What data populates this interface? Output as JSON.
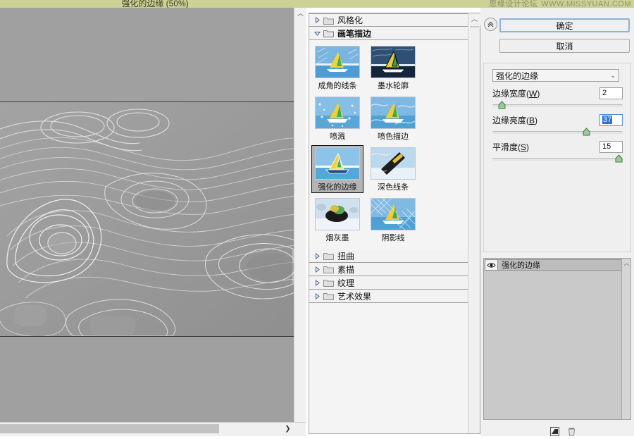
{
  "window": {
    "title": "强化的边缘 (50%)",
    "watermark_cn": "思缘设计论坛",
    "watermark_url": "WWW.MISSYUAN.COM"
  },
  "preview": {
    "zoom_label": "50%",
    "scroll_right_arrow": "❯",
    "scroll_up_arrow": "︿"
  },
  "filters_panel": {
    "categories": [
      {
        "label": "风格化",
        "open": false
      },
      {
        "label": "画笔描边",
        "open": true
      },
      {
        "label": "扭曲",
        "open": false
      },
      {
        "label": "素描",
        "open": false
      },
      {
        "label": "纹理",
        "open": false
      },
      {
        "label": "艺术效果",
        "open": false
      }
    ],
    "thumbnails": [
      {
        "label": "成角的线条",
        "selected": false,
        "style": "angled"
      },
      {
        "label": "墨水轮廓",
        "selected": false,
        "style": "ink"
      },
      {
        "label": "喷溅",
        "selected": false,
        "style": "spatter"
      },
      {
        "label": "喷色描边",
        "selected": false,
        "style": "sprayed"
      },
      {
        "label": "强化的边缘",
        "selected": true,
        "style": "accented"
      },
      {
        "label": "深色线条",
        "selected": false,
        "style": "dark"
      },
      {
        "label": "烟灰墨",
        "selected": false,
        "style": "sumi"
      },
      {
        "label": "阴影线",
        "selected": false,
        "style": "crosshatch"
      }
    ]
  },
  "right_panel": {
    "ok_label": "确定",
    "cancel_label": "取消",
    "collapse_icon": "collapse-arrows-icon",
    "filter_select": {
      "value": "强化的边缘",
      "chevron": "⌄"
    },
    "sliders": [
      {
        "label": "边缘宽度",
        "mnemonic": "W",
        "value": "2",
        "percent": 7,
        "focused": false
      },
      {
        "label": "边缘亮度",
        "mnemonic": "B",
        "value": "37",
        "percent": 72,
        "focused": true
      },
      {
        "label": "平滑度",
        "mnemonic": "S",
        "value": "15",
        "percent": 97,
        "focused": false
      }
    ],
    "layers": [
      {
        "name": "强化的边缘",
        "visible": true
      }
    ],
    "tools": {
      "new_effect_layer": "new-effect-layer-icon",
      "delete_effect_layer": "delete-effect-layer-icon"
    }
  },
  "colors": {
    "titlebar": "#ccd194",
    "panel_bg": "#f0f0f0",
    "accent": "#8cb3d9",
    "selection_blue": "#2f6fd0",
    "preview_gray": "#9a9a9a"
  }
}
